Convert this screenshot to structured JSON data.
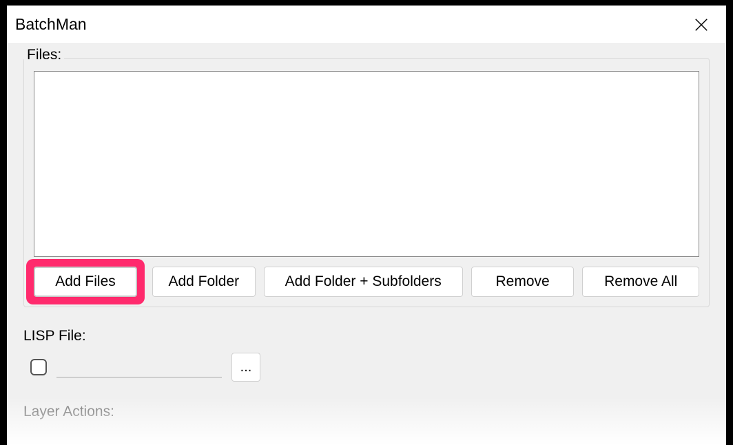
{
  "window": {
    "title": "BatchMan"
  },
  "files": {
    "legend": "Files:",
    "buttons": {
      "add_files": "Add Files",
      "add_folder": "Add Folder",
      "add_folder_sub": "Add Folder + Subfolders",
      "remove": "Remove",
      "remove_all": "Remove All"
    }
  },
  "lisp": {
    "label": "LISP File:",
    "value": "",
    "browse": "..."
  },
  "layer_actions": {
    "label": "Layer Actions:"
  }
}
